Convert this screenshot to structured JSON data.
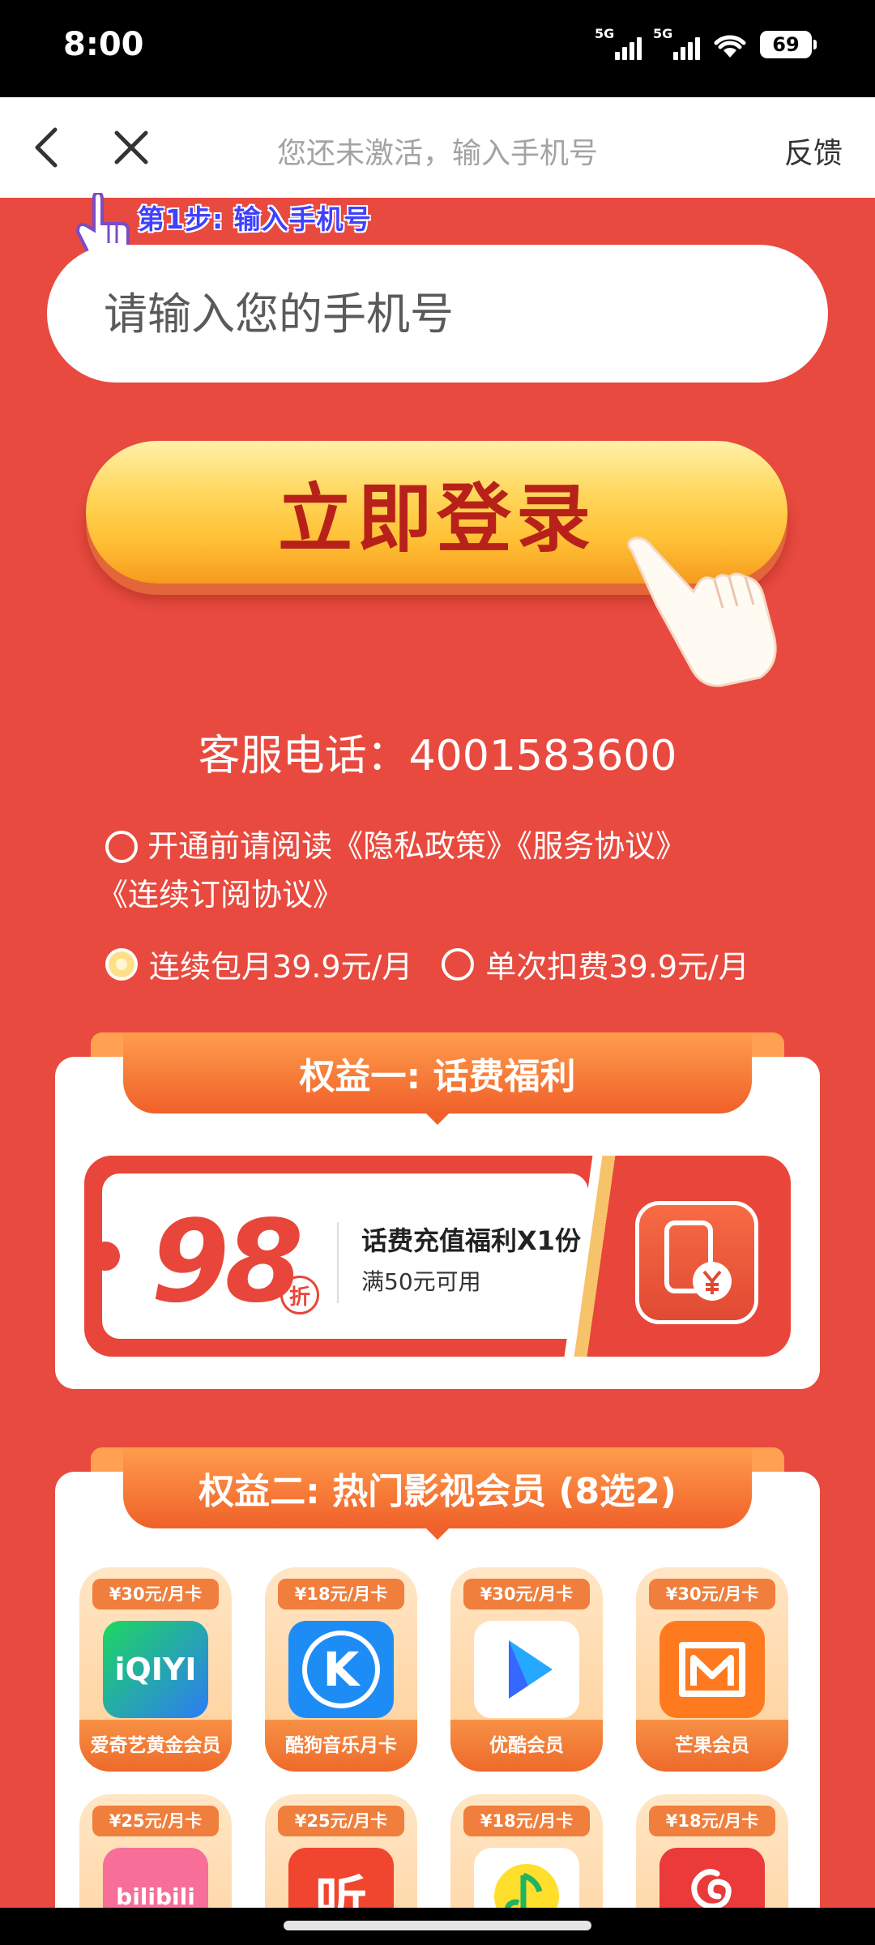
{
  "status_bar": {
    "time": "8:00",
    "battery": "69",
    "network1": "5G",
    "network2": "5G"
  },
  "nav": {
    "title": "您还未激活，输入手机号",
    "feedback": "反馈"
  },
  "step": {
    "label": "第1步: 输入手机号"
  },
  "phone_input": {
    "placeholder": "请输入您的手机号"
  },
  "login_button": {
    "label": "立即登录"
  },
  "service": {
    "text": "客服电话：4001583600"
  },
  "agreement": {
    "text_line1": "开通前请阅读《隐私政策》《服务协议》",
    "text_line2": "《连续订阅协议》"
  },
  "plans": [
    {
      "label": "连续包月39.9元/月",
      "selected": true
    },
    {
      "label": "单次扣费39.9元/月",
      "selected": false
    }
  ],
  "benefit1": {
    "title": "权益一: 话费福利",
    "discount": "98",
    "discount_unit": "折",
    "coupon_title": "话费充值福利X1份",
    "coupon_sub": "满50元可用"
  },
  "benefit2": {
    "title": "权益二: 热门影视会员 (8选2)",
    "items": [
      {
        "price": "¥30元/月卡",
        "name": "爱奇艺黄金会员",
        "logo_text": "iQIYI",
        "icon": "iqiyi-logo-icon"
      },
      {
        "price": "¥18元/月卡",
        "name": "酷狗音乐月卡",
        "logo_text": "K",
        "icon": "kugou-logo-icon"
      },
      {
        "price": "¥30元/月卡",
        "name": "优酷会员",
        "logo_text": "",
        "icon": "youku-logo-icon"
      },
      {
        "price": "¥30元/月卡",
        "name": "芒果会员",
        "logo_text": "",
        "icon": "mango-logo-icon"
      },
      {
        "price": "¥25元/月卡",
        "name": "",
        "logo_text": "bilibili",
        "icon": "bilibili-logo-icon"
      },
      {
        "price": "¥25元/月卡",
        "name": "",
        "logo_text": "听",
        "icon": "ximalaya-logo-icon"
      },
      {
        "price": "¥18元/月卡",
        "name": "",
        "logo_text": "",
        "icon": "qqmusic-logo-icon"
      },
      {
        "price": "¥18元/月卡",
        "name": "",
        "logo_text": "",
        "icon": "netease-music-logo-icon"
      }
    ]
  },
  "colors": {
    "page_bg": "#e84a3f",
    "accent_orange": "#f0602a",
    "gold": "#ffc035",
    "text_red": "#b8211a"
  }
}
